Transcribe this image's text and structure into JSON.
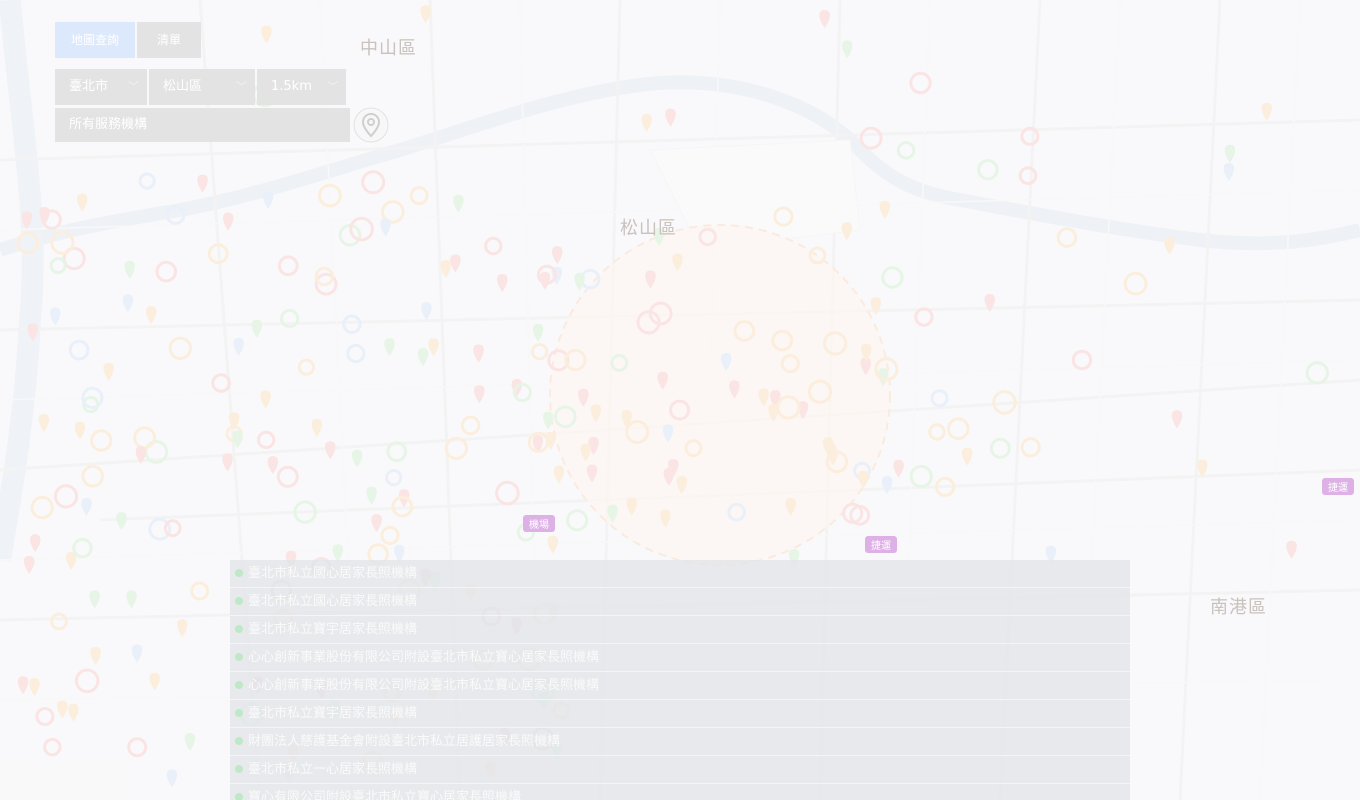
{
  "tabs": [
    {
      "label": "地圖查詢",
      "active": true
    },
    {
      "label": "清單",
      "active": false
    }
  ],
  "filters": {
    "city": "臺北市",
    "district": "松山區",
    "radius": "1.5km"
  },
  "search": {
    "placeholder": "所有服務機構"
  },
  "map_labels": {
    "district_1": "中山區",
    "district_2": "松山區",
    "district_3": "南港區"
  },
  "badges": [
    "機場",
    "捷運",
    "捷運"
  ],
  "results": [
    "臺北市私立國心居家長照機構",
    "臺北市私立國心居家長照機構",
    "臺北市私立寶宇居家長照機構",
    "心心創新事業股份有限公司附設臺北市私立寶心居家長照機構",
    "心心創新事業股份有限公司附設臺北市私立寶心居家長照機構",
    "臺北市私立寶宇居家長照機構",
    "財團法人慈護基金會附設臺北市私立居護居家長照機構",
    "臺北市私立一心居家長照機構",
    "寶心有限公司附設臺北市私立寶心居家長照機構"
  ],
  "colors": {
    "pin_red": "#f3b7b7",
    "pin_orange": "#f6d3a7",
    "pin_green": "#bfe5c0",
    "pin_blue": "#c7d8ee",
    "radius_fill": "#f9e7dc",
    "radius_stroke": "#f4c9a8"
  },
  "icons": {
    "locate": "location-pin-icon",
    "chevron": "chevron-down-icon",
    "result_dot": "green-dot-icon"
  }
}
